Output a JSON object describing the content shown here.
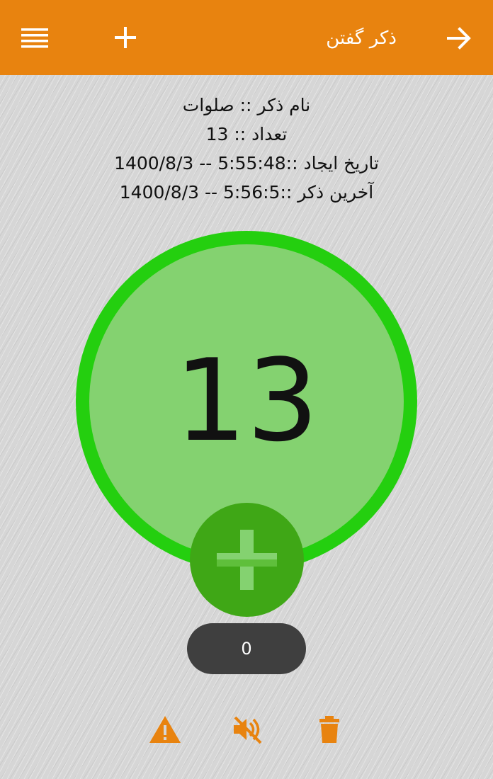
{
  "appbar": {
    "title": "ذکر گفتن",
    "icons": {
      "menu": "menu-icon",
      "add": "plus-icon",
      "back": "arrow-right-icon"
    }
  },
  "info": {
    "name_label": "نام ذکر :: ",
    "name_value": "صلوات",
    "count_label": "تعداد :: ",
    "count_value": "13",
    "created_label": "تاریخ ایجاد ::",
    "created_value": "1400/8/3 -- 5:55:48",
    "last_label": "آخرین ذکر ::",
    "last_value": "1400/8/3 -- 5:56:5"
  },
  "counter": {
    "value": "13"
  },
  "session_count": "0",
  "bottom_icons": [
    "warning-icon",
    "volume-mute-icon",
    "trash-icon"
  ],
  "colors": {
    "appbar": "#e8830f",
    "ring": "#24cf0f",
    "ring_fill": "#84d270",
    "plus_button": "#3fa716",
    "pill": "#3f3f3f",
    "icon_accent": "#e8830f"
  }
}
